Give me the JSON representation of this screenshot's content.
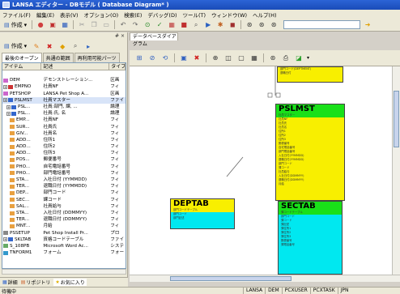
{
  "window": {
    "title": "LANSA エディター - DBモデル ( Database Diagram* )"
  },
  "menu": [
    "ファイル(F)",
    "編集(E)",
    "表示(V)",
    "オプション(O)",
    "検索(E)",
    "デバッグ(D)",
    "ツール(T)",
    "ウィンドウ(W)",
    "ヘルプ(H)"
  ],
  "toolbar": {
    "new_label": "作成"
  },
  "left_panel": {
    "close_label": "# ×",
    "new_label": "作成",
    "tabs": [
      "最後のオープン",
      "共通の範囲",
      "再利用可能パーツ"
    ],
    "columns": [
      "アイテム",
      "記述",
      "タイプ"
    ],
    "rows": [
      {
        "name": "",
        "desc": "",
        "type": ""
      },
      {
        "name": "DEM",
        "desc": "デモンストレーション...",
        "type": "区画",
        "icon": "#cc66cc"
      },
      {
        "name": "EMPNO",
        "desc": "社員NF",
        "type": "フィ",
        "icon": "#cc3333",
        "exp": true
      },
      {
        "name": "PETSHOP",
        "desc": "LANSA Pet Shop A...",
        "type": "区画",
        "icon": "#cc66cc"
      },
      {
        "name": "PSLMST",
        "desc": "社員マスター",
        "type": "ファイ",
        "icon": "#3366cc",
        "exp": true,
        "sel": true
      },
      {
        "name": "PSL...",
        "desc": "社員:部門, 課, ...",
        "type": "論理",
        "icon": "#3366cc",
        "exp": true,
        "indent": 1
      },
      {
        "name": "PSL...",
        "desc": "社員:氏, 名",
        "type": "論理",
        "icon": "#3366cc",
        "exp": true,
        "indent": 1
      },
      {
        "name": "EMP...",
        "desc": "社員NF",
        "type": "フィ",
        "icon": "#e8a040",
        "indent": 2
      },
      {
        "name": "SUR...",
        "desc": "社員氏",
        "type": "フィ",
        "icon": "#e8a040",
        "indent": 2
      },
      {
        "name": "GIV...",
        "desc": "社員名",
        "type": "フィ",
        "icon": "#e8a040",
        "indent": 2
      },
      {
        "name": "ADD...",
        "desc": "住所1",
        "type": "フィ",
        "icon": "#e8a040",
        "indent": 2
      },
      {
        "name": "ADD...",
        "desc": "住所2",
        "type": "フィ",
        "icon": "#e8a040",
        "indent": 2
      },
      {
        "name": "ADD...",
        "desc": "住所3",
        "type": "フィ",
        "icon": "#e8a040",
        "indent": 2
      },
      {
        "name": "POS...",
        "desc": "郵便番号",
        "type": "フィ",
        "icon": "#e8a040",
        "indent": 2
      },
      {
        "name": "PHO...",
        "desc": "自宅電話番号",
        "type": "フィ",
        "icon": "#e8a040",
        "indent": 2
      },
      {
        "name": "PHO...",
        "desc": "部門電話番号",
        "type": "フィ",
        "icon": "#e8a040",
        "indent": 2
      },
      {
        "name": "STA...",
        "desc": "入社日付 (YYMMDD)",
        "type": "フィ",
        "icon": "#e8a040",
        "indent": 2
      },
      {
        "name": "TER...",
        "desc": "退職日付 (YYMMDD)",
        "type": "フィ",
        "icon": "#e8a040",
        "indent": 2
      },
      {
        "name": "DEP...",
        "desc": "部門コード",
        "type": "フィ",
        "icon": "#e8a040",
        "indent": 2
      },
      {
        "name": "SEC...",
        "desc": "課コード",
        "type": "フィ",
        "icon": "#e8a040",
        "indent": 2
      },
      {
        "name": "SAL...",
        "desc": "社員給与",
        "type": "フィ",
        "icon": "#e8a040",
        "indent": 2
      },
      {
        "name": "STA...",
        "desc": "入社日付 (DDMMYY)",
        "type": "フィ",
        "icon": "#e8a040",
        "indent": 2
      },
      {
        "name": "TER...",
        "desc": "退職日付 (DDMMYY)",
        "type": "フィ",
        "icon": "#e8a040",
        "indent": 2
      },
      {
        "name": "MNT...",
        "desc": "月給",
        "type": "フィ",
        "icon": "#e8a040",
        "indent": 2
      },
      {
        "name": "PSSETUP",
        "desc": "Pet Shop Install Pr...",
        "type": "プロ",
        "icon": "#888888"
      },
      {
        "name": "SKLTAB",
        "desc": "資格コードテーブル",
        "type": "ファイ",
        "icon": "#3366cc",
        "exp": true
      },
      {
        "name": "S_108PB",
        "desc": "Microsoft Word Ac...",
        "type": "システ",
        "icon": "#66aa66"
      },
      {
        "name": "TNFORM1",
        "desc": "フォーム",
        "type": "フォー",
        "icon": "#3399cc"
      }
    ],
    "bottom_tabs": [
      "詳細",
      "リポジトリ",
      "お気に入り"
    ]
  },
  "document_tab": "データベースダイアグラム",
  "diagram": {
    "entities": [
      {
        "id": "top",
        "name": "",
        "color": "#f8ef00",
        "attrs": [
          "部門コード(DEPTMENT)",
          "退職日付"
        ]
      },
      {
        "id": "pslmst",
        "name": "PSLMST",
        "head_color": "#19e019",
        "color": "#f8ef00",
        "attrs": [
          "社員マスター",
          "社員NF",
          "社員氏",
          "社員名",
          "住所1",
          "住所2",
          "住所3",
          "郵便番号",
          "自宅電話番号",
          "部門電話番号",
          "入社日付(YYMMDD)",
          "退職日付(YYMMDD)",
          "部門コード",
          "課コード",
          "社員給与",
          "入社日付(DDMMYY)",
          "退職日付(DDMMYY)",
          "月給"
        ]
      },
      {
        "id": "deptab",
        "name": "DEPTAB",
        "head_color": "#f8ef00",
        "color": "#00e8f0",
        "attrs": [
          "部門コードテーブル",
          "部門コード",
          "部門記述"
        ]
      },
      {
        "id": "sectab",
        "name": "SECTAB",
        "head_color": "#19e019",
        "color": "#00e8f0",
        "attrs": [
          "課コードテーブル",
          "部門コード",
          "課コード",
          "課記述",
          "課住所1",
          "課住所2",
          "課住所3",
          "郵便番号",
          "課電話番号"
        ]
      }
    ]
  },
  "status": {
    "message": "待機中",
    "cells": [
      "LANSA",
      "DEM",
      "PCXUSER",
      "PCXTASK",
      "JPN"
    ]
  }
}
